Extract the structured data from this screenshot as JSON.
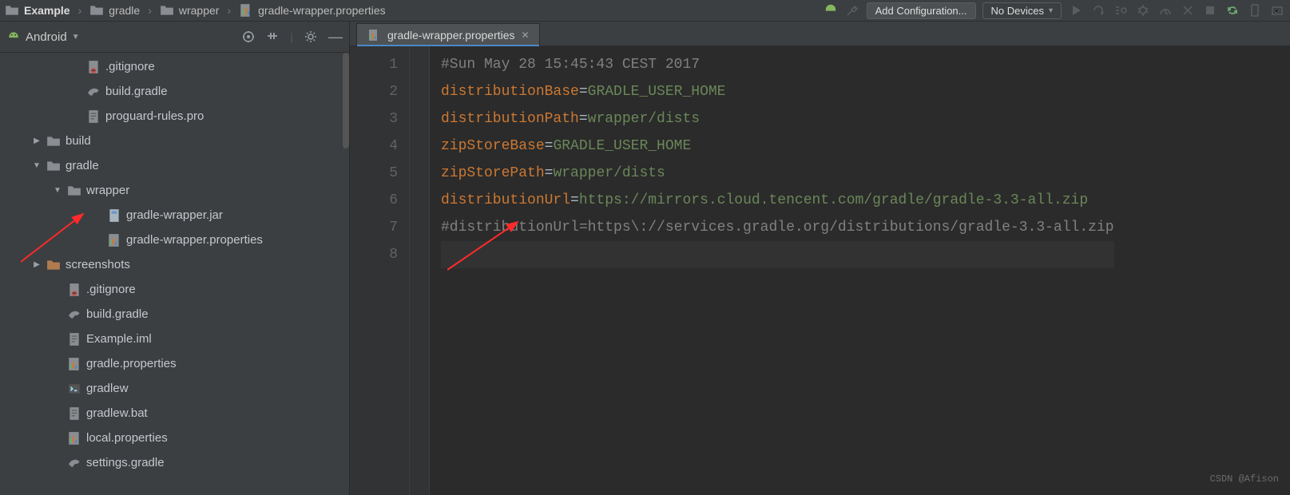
{
  "breadcrumb": {
    "root": "Example",
    "p1": "gradle",
    "p2": "wrapper",
    "file": "gradle-wrapper.properties"
  },
  "toolbar": {
    "add_config": "Add Configuration...",
    "devices": "No Devices"
  },
  "panel": {
    "title": "Android"
  },
  "tree": [
    {
      "indent": 72,
      "arrow": "",
      "icon": "gitignore",
      "label": ".gitignore"
    },
    {
      "indent": 72,
      "arrow": "",
      "icon": "gradle",
      "label": "build.gradle"
    },
    {
      "indent": 72,
      "arrow": "",
      "icon": "pro",
      "label": "proguard-rules.pro"
    },
    {
      "indent": 22,
      "arrow": "right",
      "icon": "folder",
      "label": "build"
    },
    {
      "indent": 22,
      "arrow": "down",
      "icon": "folder",
      "label": "gradle"
    },
    {
      "indent": 48,
      "arrow": "down",
      "icon": "folder",
      "label": "wrapper"
    },
    {
      "indent": 98,
      "arrow": "",
      "icon": "jar",
      "label": "gradle-wrapper.jar"
    },
    {
      "indent": 98,
      "arrow": "",
      "icon": "props",
      "label": "gradle-wrapper.properties"
    },
    {
      "indent": 22,
      "arrow": "right",
      "icon": "folder-res",
      "label": "screenshots"
    },
    {
      "indent": 48,
      "arrow": "",
      "icon": "gitignore",
      "label": ".gitignore"
    },
    {
      "indent": 48,
      "arrow": "",
      "icon": "gradle",
      "label": "build.gradle"
    },
    {
      "indent": 48,
      "arrow": "",
      "icon": "iml",
      "label": "Example.iml"
    },
    {
      "indent": 48,
      "arrow": "",
      "icon": "props",
      "label": "gradle.properties"
    },
    {
      "indent": 48,
      "arrow": "",
      "icon": "sh",
      "label": "gradlew"
    },
    {
      "indent": 48,
      "arrow": "",
      "icon": "bat",
      "label": "gradlew.bat"
    },
    {
      "indent": 48,
      "arrow": "",
      "icon": "props",
      "label": "local.properties"
    },
    {
      "indent": 48,
      "arrow": "",
      "icon": "gradle",
      "label": "settings.gradle"
    }
  ],
  "tab": {
    "label": "gradle-wrapper.properties"
  },
  "code": {
    "lines": [
      {
        "n": "1",
        "type": "comment",
        "text": "#Sun May 28 15:45:43 CEST 2017"
      },
      {
        "n": "2",
        "type": "kv",
        "k": "distributionBase",
        "v": "GRADLE_USER_HOME"
      },
      {
        "n": "3",
        "type": "kv",
        "k": "distributionPath",
        "v": "wrapper/dists"
      },
      {
        "n": "4",
        "type": "kv",
        "k": "zipStoreBase",
        "v": "GRADLE_USER_HOME"
      },
      {
        "n": "5",
        "type": "kv",
        "k": "zipStorePath",
        "v": "wrapper/dists"
      },
      {
        "n": "6",
        "type": "kv",
        "k": "distributionUrl",
        "v": "https://mirrors.cloud.tencent.com/gradle/gradle-3.3-all.zip"
      },
      {
        "n": "7",
        "type": "comment",
        "text": "#distributionUrl=https\\://services.gradle.org/distributions/gradle-3.3-all.zip"
      },
      {
        "n": "8",
        "type": "empty",
        "text": ""
      }
    ]
  },
  "watermark": "CSDN @Afison"
}
